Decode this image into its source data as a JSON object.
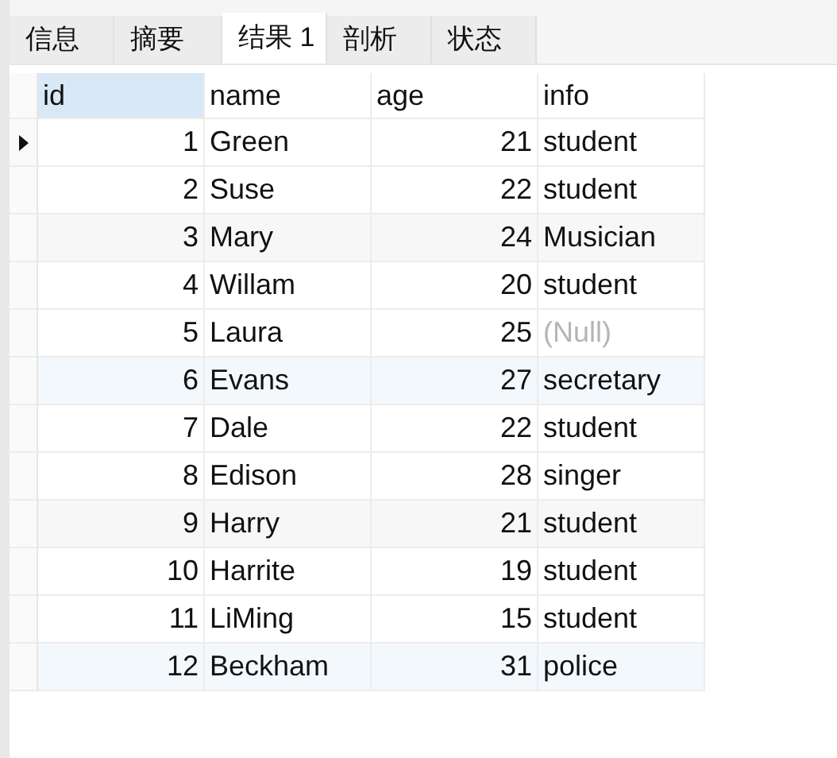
{
  "tabs": [
    {
      "label": "信息",
      "selected": false
    },
    {
      "label": "摘要",
      "selected": false
    },
    {
      "label": "结果 1",
      "selected": true
    },
    {
      "label": "剖析",
      "selected": false
    },
    {
      "label": "状态",
      "selected": false
    }
  ],
  "table": {
    "columns": [
      {
        "label": "id",
        "selected": true
      },
      {
        "label": "name",
        "selected": false
      },
      {
        "label": "age",
        "selected": false
      },
      {
        "label": "info",
        "selected": false
      }
    ],
    "rows": [
      {
        "id": "1",
        "name": "Green",
        "age": "21",
        "info": "student",
        "info_null": false,
        "selected": true
      },
      {
        "id": "2",
        "name": "Suse",
        "age": "22",
        "info": "student",
        "info_null": false,
        "selected": false
      },
      {
        "id": "3",
        "name": "Mary",
        "age": "24",
        "info": "Musician",
        "info_null": false,
        "selected": false
      },
      {
        "id": "4",
        "name": "Willam",
        "age": "20",
        "info": "student",
        "info_null": false,
        "selected": false
      },
      {
        "id": "5",
        "name": "Laura",
        "age": "25",
        "info": "(Null)",
        "info_null": true,
        "selected": false
      },
      {
        "id": "6",
        "name": "Evans",
        "age": "27",
        "info": "secretary",
        "info_null": false,
        "selected": false
      },
      {
        "id": "7",
        "name": "Dale",
        "age": "22",
        "info": "student",
        "info_null": false,
        "selected": false
      },
      {
        "id": "8",
        "name": "Edison",
        "age": "28",
        "info": "singer",
        "info_null": false,
        "selected": false
      },
      {
        "id": "9",
        "name": "Harry",
        "age": "21",
        "info": "student",
        "info_null": false,
        "selected": false
      },
      {
        "id": "10",
        "name": "Harrite",
        "age": "19",
        "info": "student",
        "info_null": false,
        "selected": false
      },
      {
        "id": "11",
        "name": "LiMing",
        "age": "15",
        "info": "student",
        "info_null": false,
        "selected": false
      },
      {
        "id": "12",
        "name": "Beckham",
        "age": "31",
        "info": "police",
        "info_null": false,
        "selected": false
      }
    ]
  }
}
